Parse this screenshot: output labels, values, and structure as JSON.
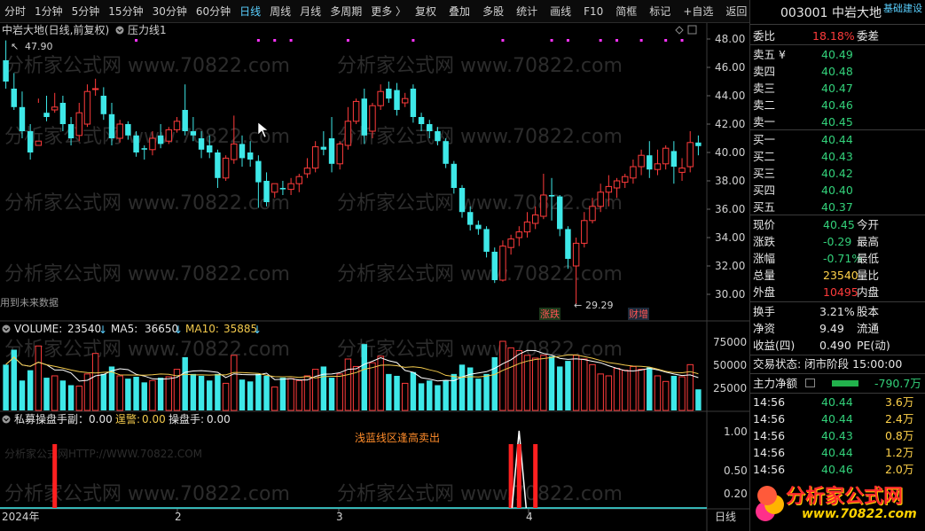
{
  "toolbar": {
    "periods": [
      "分时",
      "1分钟",
      "5分钟",
      "15分钟",
      "30分钟",
      "60分钟",
      "日线",
      "周线",
      "月线",
      "多周期",
      "更多 〉"
    ],
    "active_period": "日线",
    "tools": [
      "复权",
      "叠加",
      "多股",
      "统计",
      "画线",
      "F10",
      "简框",
      "标记",
      "+自选",
      "返回"
    ]
  },
  "chart": {
    "stock_title": "中岩大地(日线,前复权)",
    "indicator_label": "压力线1",
    "price_high_label": "47.90",
    "price_low_label": "29.29",
    "future_data_label": "用到未来数据",
    "badge_1": "涨跌",
    "badge_2": "财增",
    "watermark": "分析家公式网 www.70822.com",
    "watermark_url": "分析家公式网HTTP://WWW.70822.COM",
    "price_ticks": [
      "48.00",
      "46.00",
      "44.00",
      "42.00",
      "40.00",
      "38.00",
      "36.00",
      "34.00",
      "32.00",
      "30.00"
    ]
  },
  "volume": {
    "name_label": "VOLUME:",
    "value": "23540",
    "ma5_label": "MA5:",
    "ma5": "36650",
    "ma10_label": "MA10:",
    "ma10": "35885",
    "ticks": [
      "75000",
      "50000",
      "25000"
    ]
  },
  "indicator": {
    "title": "私募操盘手副：0.00",
    "alarm_label": "逞警:",
    "alarm_value": "0.00",
    "trader_label": "操盘手:",
    "trader_value": "0.00",
    "note": "浅蓝线区逢高卖出",
    "ticks": [
      "1.00",
      "0.50",
      "0.20"
    ]
  },
  "timeline": {
    "labels": [
      "2024年",
      "2",
      "3",
      "4"
    ],
    "period_label": "日线"
  },
  "chart_data": {
    "type": "candlestick",
    "title": "中岩大地(日线,前复权)",
    "ylim": [
      29,
      49
    ],
    "x_labels": [
      "2024年",
      "2",
      "3",
      "4"
    ],
    "candles": [
      [
        46.5,
        47.9,
        45.0,
        44.5
      ],
      [
        44.5,
        45.6,
        43.2,
        43.0
      ],
      [
        43.2,
        44.3,
        41.5,
        41.0
      ],
      [
        41.5,
        42.0,
        40.0,
        39.5
      ],
      [
        40.5,
        43.5,
        40.8,
        43.8
      ],
      [
        42.8,
        44.0,
        42.5,
        42.2
      ],
      [
        43.0,
        44.2,
        43.2,
        42.8
      ],
      [
        43.5,
        44.0,
        42.0,
        41.5
      ],
      [
        42.0,
        42.5,
        41.0,
        40.5
      ],
      [
        41.2,
        43.5,
        42.8,
        40.8
      ],
      [
        42.0,
        44.8,
        44.3,
        41.8
      ],
      [
        44.5,
        45.2,
        44.5,
        44.0
      ],
      [
        44.0,
        44.6,
        42.7,
        42.3
      ],
      [
        42.7,
        43.5,
        41.0,
        40.5
      ],
      [
        41.0,
        42.3,
        42.0,
        40.7
      ],
      [
        42.0,
        42.2,
        41.2,
        40.9
      ],
      [
        41.2,
        41.5,
        40.0,
        39.7
      ],
      [
        40.3,
        40.5,
        40.2,
        39.5
      ],
      [
        40.2,
        41.5,
        41.0,
        39.8
      ],
      [
        41.2,
        42.0,
        40.6,
        40.3
      ],
      [
        40.8,
        41.8,
        41.6,
        40.6
      ],
      [
        41.6,
        42.5,
        42.2,
        41.4
      ],
      [
        43.0,
        44.8,
        41.5,
        41.2
      ],
      [
        41.5,
        42.5,
        41.2,
        40.8
      ],
      [
        41.0,
        41.5,
        40.2,
        39.6
      ],
      [
        40.5,
        41.2,
        40.0,
        39.6
      ],
      [
        40.0,
        40.2,
        38.2,
        37.5
      ],
      [
        38.2,
        39.8,
        39.6,
        38.0
      ],
      [
        39.5,
        42.6,
        40.6,
        39.2
      ],
      [
        40.6,
        41.2,
        39.6,
        39.0
      ],
      [
        40.0,
        40.8,
        39.5,
        39.0
      ],
      [
        39.4,
        39.8,
        37.9,
        36.1
      ],
      [
        38.0,
        38.6,
        36.5,
        36.2
      ],
      [
        37.2,
        37.6,
        37.8,
        36.8
      ],
      [
        37.5,
        38.0,
        37.4,
        37.0
      ],
      [
        37.4,
        38.2,
        37.8,
        37.0
      ],
      [
        37.8,
        38.5,
        38.3,
        37.2
      ],
      [
        38.5,
        39.6,
        38.9,
        38.2
      ],
      [
        38.9,
        40.8,
        40.4,
        38.6
      ],
      [
        40.4,
        41.5,
        40.2,
        39.8
      ],
      [
        41.0,
        42.5,
        39.2,
        38.6
      ],
      [
        39.2,
        40.8,
        40.6,
        38.8
      ],
      [
        40.5,
        43.2,
        42.2,
        40.2
      ],
      [
        42.2,
        43.8,
        43.6,
        42.0
      ],
      [
        43.8,
        44.5,
        41.2,
        40.6
      ],
      [
        41.5,
        43.5,
        43.3,
        41.0
      ],
      [
        43.3,
        44.8,
        44.3,
        43.0
      ],
      [
        44.5,
        45.0,
        43.8,
        43.5
      ],
      [
        44.4,
        44.9,
        43.0,
        42.6
      ],
      [
        43.5,
        44.2,
        43.8,
        43.2
      ],
      [
        44.5,
        44.8,
        42.5,
        42.1
      ],
      [
        42.5,
        42.8,
        42.0,
        41.5
      ],
      [
        42.0,
        42.3,
        41.5,
        41.0
      ],
      [
        41.5,
        41.8,
        40.8,
        40.5
      ],
      [
        40.8,
        41.0,
        39.2,
        38.9
      ],
      [
        39.2,
        39.4,
        37.5,
        37.1
      ],
      [
        37.5,
        37.7,
        35.8,
        35.4
      ],
      [
        35.8,
        36.2,
        34.9,
        34.5
      ],
      [
        34.9,
        35.2,
        34.6,
        34.2
      ],
      [
        34.6,
        34.8,
        33.0,
        32.6
      ],
      [
        33.0,
        33.3,
        31.0,
        30.8
      ],
      [
        31.0,
        33.8,
        33.4,
        30.9
      ],
      [
        33.3,
        34.2,
        33.9,
        32.8
      ],
      [
        34.0,
        34.8,
        34.4,
        33.4
      ],
      [
        34.4,
        35.8,
        35.1,
        34.0
      ],
      [
        35.0,
        36.2,
        35.6,
        34.6
      ],
      [
        35.5,
        38.5,
        37.0,
        35.3
      ],
      [
        37.0,
        38.2,
        36.9,
        35.2
      ],
      [
        36.9,
        37.0,
        34.6,
        34.1
      ],
      [
        34.6,
        34.8,
        32.5,
        31.8
      ],
      [
        32.0,
        34.0,
        33.6,
        29.29
      ],
      [
        33.6,
        35.8,
        35.2,
        33.3
      ],
      [
        35.2,
        36.8,
        36.2,
        35.0
      ],
      [
        36.2,
        37.8,
        37.2,
        35.8
      ],
      [
        37.2,
        38.4,
        37.6,
        36.2
      ],
      [
        37.5,
        38.2,
        38.0,
        36.8
      ],
      [
        37.9,
        38.5,
        38.3,
        37.5
      ],
      [
        38.2,
        39.5,
        39.0,
        37.8
      ],
      [
        39.0,
        40.2,
        39.8,
        38.4
      ],
      [
        39.8,
        40.8,
        38.8,
        38.2
      ],
      [
        38.8,
        40.2,
        39.2,
        38.4
      ],
      [
        39.2,
        40.5,
        40.3,
        38.8
      ],
      [
        40.1,
        40.8,
        39.0,
        37.8
      ],
      [
        38.6,
        39.6,
        38.9,
        38.0
      ],
      [
        39.0,
        41.5,
        40.7,
        38.6
      ],
      [
        40.7,
        41.2,
        40.45,
        39.8
      ]
    ],
    "volumes": [
      50000,
      66000,
      33000,
      44000,
      70000,
      36000,
      38000,
      33000,
      28000,
      27000,
      40000,
      62000,
      40000,
      48000,
      38000,
      35000,
      37000,
      31000,
      33000,
      36000,
      37000,
      45000,
      58000,
      40000,
      38000,
      33000,
      40000,
      30000,
      60000,
      34000,
      32000,
      40000,
      38000,
      26000,
      36000,
      35000,
      33000,
      38000,
      45000,
      48000,
      36000,
      40000,
      56000,
      48000,
      72000,
      52000,
      59000,
      40000,
      38000,
      30000,
      42000,
      30000,
      33000,
      28000,
      33000,
      40000,
      50000,
      47000,
      35000,
      40000,
      58000,
      75000,
      68000,
      65000,
      60000,
      57000,
      60000,
      59000,
      48000,
      54000,
      60000,
      56000,
      50000,
      40000,
      38000,
      46000,
      44000,
      48000,
      45000,
      47000,
      38000,
      32000,
      38000,
      37000,
      50000,
      23540
    ],
    "spikes": [
      {
        "index": 6,
        "value": 1.0
      },
      {
        "index": 62,
        "value": 1.0
      },
      {
        "index": 65,
        "value": 1.0
      }
    ],
    "white_peak": {
      "index": 63,
      "value": 1.0
    }
  },
  "panel": {
    "code": "003001",
    "name": "中岩大地",
    "corner": "基础建设",
    "webi_label": "委比",
    "webi_value": "18.18%",
    "weicha_label": "委差",
    "sells": [
      {
        "label": "卖五 ¥",
        "price": "40.49"
      },
      {
        "label": "卖四",
        "price": "40.48"
      },
      {
        "label": "卖三",
        "price": "40.47"
      },
      {
        "label": "卖二",
        "price": "40.46"
      },
      {
        "label": "卖一",
        "price": "40.45"
      }
    ],
    "buys": [
      {
        "label": "买一",
        "price": "40.44"
      },
      {
        "label": "买二",
        "price": "40.43"
      },
      {
        "label": "买三",
        "price": "40.42"
      },
      {
        "label": "买四",
        "price": "40.40"
      },
      {
        "label": "买五",
        "price": "40.37"
      }
    ],
    "stats": [
      {
        "l1": "现价",
        "v1": "40.45",
        "l2": "今开",
        "color": "green"
      },
      {
        "l1": "涨跌",
        "v1": "-0.29",
        "l2": "最高",
        "color": "green"
      },
      {
        "l1": "涨幅",
        "v1": "-0.71%",
        "l2": "最低",
        "color": "green"
      },
      {
        "l1": "总量",
        "v1": "23540",
        "l2": "量比",
        "color": "yellow"
      },
      {
        "l1": "外盘",
        "v1": "10495",
        "l2": "内盘",
        "color": "red"
      }
    ],
    "stats2": [
      {
        "l1": "换手",
        "v1": "3.21%",
        "l2": "股本"
      },
      {
        "l1": "净资",
        "v1": "9.49",
        "l2": "流通"
      },
      {
        "l1": "收益(四)",
        "v1": "0.490",
        "l2": "PE(动)"
      }
    ],
    "trade_status": "交易状态: 闭市阶段 15:00:00",
    "main_flow_label": "主力净额",
    "main_flow_value": "-790.7万",
    "ticks": [
      {
        "time": "14:56",
        "price": "40.44",
        "vol": "3.6万"
      },
      {
        "time": "14:56",
        "price": "40.44",
        "vol": "2.4万"
      },
      {
        "time": "14:56",
        "price": "40.43",
        "vol": "0.8万"
      },
      {
        "time": "14:56",
        "price": "40.44",
        "vol": "1.2万"
      },
      {
        "time": "14:56",
        "price": "40.46",
        "vol": "2.0万"
      },
      {
        "time": "14:56",
        "price": "40.46",
        "vol": "0.4万"
      }
    ],
    "logo_text": "分析家公式网",
    "logo_url": "www.70822.com"
  },
  "colors": {
    "up": "#ff3b3b",
    "down": "#3ee8e8",
    "ma5": "#ffffff",
    "ma10": "#f2c94c",
    "magenta": "#ff33ff"
  }
}
